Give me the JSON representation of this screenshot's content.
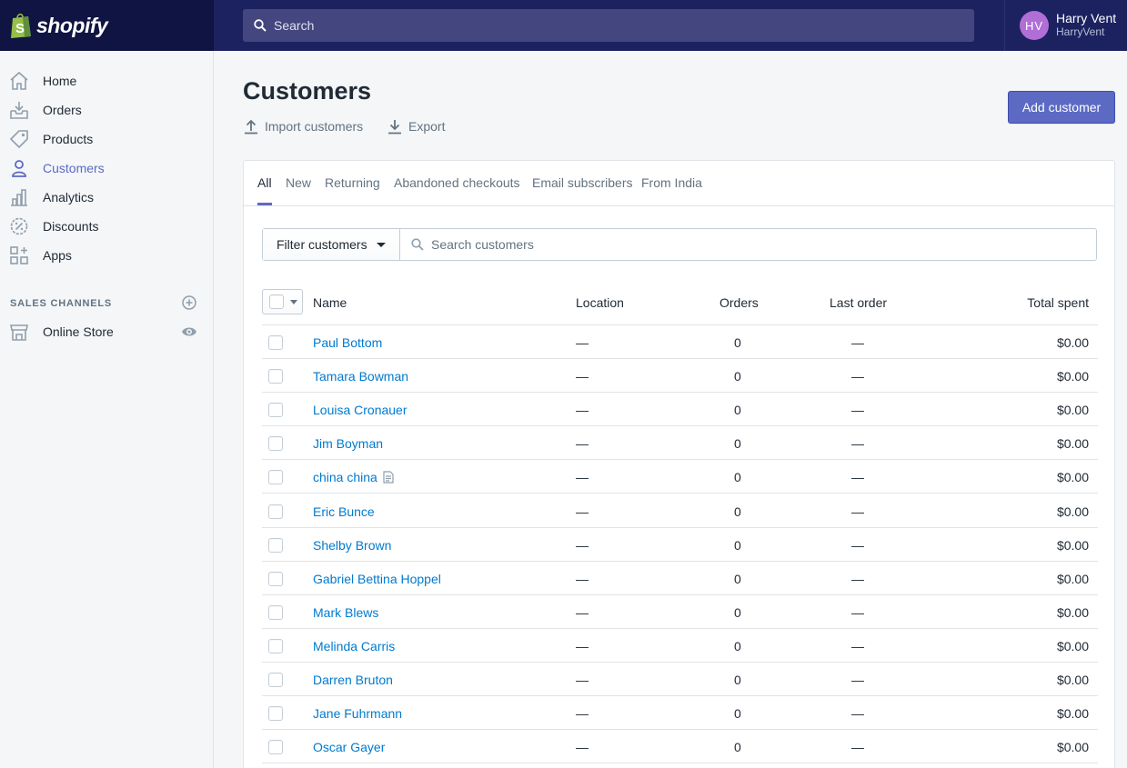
{
  "brand": {
    "name": "shopify"
  },
  "topbar": {
    "search_placeholder": "Search",
    "user": {
      "initials": "HV",
      "name": "Harry Vent",
      "handle": "HarryVent"
    }
  },
  "sidebar": {
    "items": [
      {
        "label": "Home",
        "icon": "home-icon"
      },
      {
        "label": "Orders",
        "icon": "orders-icon"
      },
      {
        "label": "Products",
        "icon": "tag-icon"
      },
      {
        "label": "Customers",
        "icon": "person-icon",
        "active": true
      },
      {
        "label": "Analytics",
        "icon": "analytics-icon"
      },
      {
        "label": "Discounts",
        "icon": "discount-icon"
      },
      {
        "label": "Apps",
        "icon": "apps-icon"
      }
    ],
    "sales_channels_title": "SALES CHANNELS",
    "channels": [
      {
        "label": "Online Store",
        "icon": "store-icon"
      }
    ]
  },
  "page": {
    "title": "Customers",
    "import_label": "Import customers",
    "export_label": "Export",
    "add_button": "Add customer"
  },
  "tabs": [
    "All",
    "New",
    "Returning",
    "Abandoned checkouts",
    "Email subscribers",
    "From India"
  ],
  "filter": {
    "button_label": "Filter customers",
    "search_placeholder": "Search customers"
  },
  "table": {
    "columns": [
      "Name",
      "Location",
      "Orders",
      "Last order",
      "Total spent"
    ],
    "rows": [
      {
        "name": "Paul Bottom",
        "location": "—",
        "orders": "0",
        "last_order": "—",
        "total": "$0.00"
      },
      {
        "name": "Tamara Bowman",
        "location": "—",
        "orders": "0",
        "last_order": "—",
        "total": "$0.00"
      },
      {
        "name": "Louisa Cronauer",
        "location": "—",
        "orders": "0",
        "last_order": "—",
        "total": "$0.00"
      },
      {
        "name": "Jim Boyman",
        "location": "—",
        "orders": "0",
        "last_order": "—",
        "total": "$0.00"
      },
      {
        "name": "china china",
        "location": "—",
        "orders": "0",
        "last_order": "—",
        "total": "$0.00",
        "has_note": true
      },
      {
        "name": "Eric Bunce",
        "location": "—",
        "orders": "0",
        "last_order": "—",
        "total": "$0.00"
      },
      {
        "name": "Shelby Brown",
        "location": "—",
        "orders": "0",
        "last_order": "—",
        "total": "$0.00"
      },
      {
        "name": "Gabriel Bettina Hoppel",
        "location": "—",
        "orders": "0",
        "last_order": "—",
        "total": "$0.00"
      },
      {
        "name": "Mark Blews",
        "location": "—",
        "orders": "0",
        "last_order": "—",
        "total": "$0.00"
      },
      {
        "name": "Melinda Carris",
        "location": "—",
        "orders": "0",
        "last_order": "—",
        "total": "$0.00"
      },
      {
        "name": "Darren Bruton",
        "location": "—",
        "orders": "0",
        "last_order": "—",
        "total": "$0.00"
      },
      {
        "name": "Jane Fuhrmann",
        "location": "—",
        "orders": "0",
        "last_order": "—",
        "total": "$0.00"
      },
      {
        "name": "Oscar Gayer",
        "location": "—",
        "orders": "0",
        "last_order": "—",
        "total": "$0.00"
      }
    ]
  },
  "colors": {
    "accent": "#5c6ac4",
    "link": "#007ace",
    "topbar": "#1c2260"
  }
}
